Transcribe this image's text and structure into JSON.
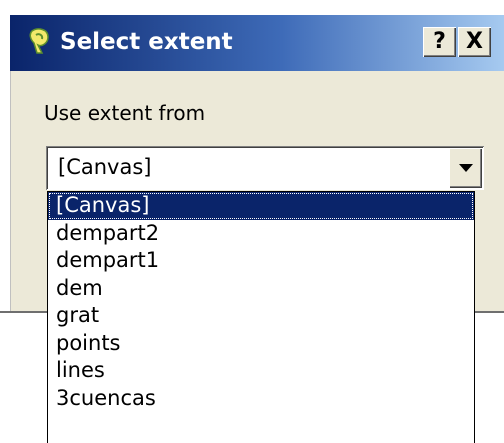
{
  "window": {
    "title": "Select extent",
    "help_label": "?",
    "close_label": "X",
    "icon": "qgis-app-icon"
  },
  "form": {
    "label": "Use extent from",
    "combo_value": "[Canvas]"
  },
  "dropdown": {
    "selected_index": 0,
    "options": [
      "[Canvas]",
      "dempart2",
      "dempart1",
      "dem",
      "grat",
      "points",
      "lines",
      "3cuencas"
    ]
  },
  "colors": {
    "title_gradient_start": "#0a246a",
    "title_gradient_end": "#a6caf0",
    "selection": "#0a246a",
    "dialog_bg": "#ece9d8"
  }
}
